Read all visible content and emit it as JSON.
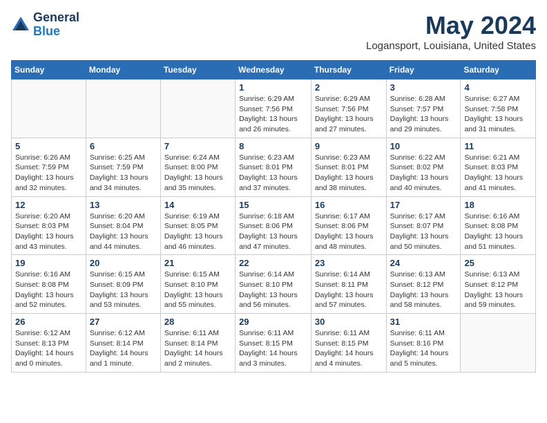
{
  "header": {
    "logo_general": "General",
    "logo_blue": "Blue",
    "month_title": "May 2024",
    "location": "Logansport, Louisiana, United States"
  },
  "calendar": {
    "days_of_week": [
      "Sunday",
      "Monday",
      "Tuesday",
      "Wednesday",
      "Thursday",
      "Friday",
      "Saturday"
    ],
    "weeks": [
      [
        {
          "day": "",
          "info": ""
        },
        {
          "day": "",
          "info": ""
        },
        {
          "day": "",
          "info": ""
        },
        {
          "day": "1",
          "info": "Sunrise: 6:29 AM\nSunset: 7:56 PM\nDaylight: 13 hours\nand 26 minutes."
        },
        {
          "day": "2",
          "info": "Sunrise: 6:29 AM\nSunset: 7:56 PM\nDaylight: 13 hours\nand 27 minutes."
        },
        {
          "day": "3",
          "info": "Sunrise: 6:28 AM\nSunset: 7:57 PM\nDaylight: 13 hours\nand 29 minutes."
        },
        {
          "day": "4",
          "info": "Sunrise: 6:27 AM\nSunset: 7:58 PM\nDaylight: 13 hours\nand 31 minutes."
        }
      ],
      [
        {
          "day": "5",
          "info": "Sunrise: 6:26 AM\nSunset: 7:59 PM\nDaylight: 13 hours\nand 32 minutes."
        },
        {
          "day": "6",
          "info": "Sunrise: 6:25 AM\nSunset: 7:59 PM\nDaylight: 13 hours\nand 34 minutes."
        },
        {
          "day": "7",
          "info": "Sunrise: 6:24 AM\nSunset: 8:00 PM\nDaylight: 13 hours\nand 35 minutes."
        },
        {
          "day": "8",
          "info": "Sunrise: 6:23 AM\nSunset: 8:01 PM\nDaylight: 13 hours\nand 37 minutes."
        },
        {
          "day": "9",
          "info": "Sunrise: 6:23 AM\nSunset: 8:01 PM\nDaylight: 13 hours\nand 38 minutes."
        },
        {
          "day": "10",
          "info": "Sunrise: 6:22 AM\nSunset: 8:02 PM\nDaylight: 13 hours\nand 40 minutes."
        },
        {
          "day": "11",
          "info": "Sunrise: 6:21 AM\nSunset: 8:03 PM\nDaylight: 13 hours\nand 41 minutes."
        }
      ],
      [
        {
          "day": "12",
          "info": "Sunrise: 6:20 AM\nSunset: 8:03 PM\nDaylight: 13 hours\nand 43 minutes."
        },
        {
          "day": "13",
          "info": "Sunrise: 6:20 AM\nSunset: 8:04 PM\nDaylight: 13 hours\nand 44 minutes."
        },
        {
          "day": "14",
          "info": "Sunrise: 6:19 AM\nSunset: 8:05 PM\nDaylight: 13 hours\nand 46 minutes."
        },
        {
          "day": "15",
          "info": "Sunrise: 6:18 AM\nSunset: 8:06 PM\nDaylight: 13 hours\nand 47 minutes."
        },
        {
          "day": "16",
          "info": "Sunrise: 6:17 AM\nSunset: 8:06 PM\nDaylight: 13 hours\nand 48 minutes."
        },
        {
          "day": "17",
          "info": "Sunrise: 6:17 AM\nSunset: 8:07 PM\nDaylight: 13 hours\nand 50 minutes."
        },
        {
          "day": "18",
          "info": "Sunrise: 6:16 AM\nSunset: 8:08 PM\nDaylight: 13 hours\nand 51 minutes."
        }
      ],
      [
        {
          "day": "19",
          "info": "Sunrise: 6:16 AM\nSunset: 8:08 PM\nDaylight: 13 hours\nand 52 minutes."
        },
        {
          "day": "20",
          "info": "Sunrise: 6:15 AM\nSunset: 8:09 PM\nDaylight: 13 hours\nand 53 minutes."
        },
        {
          "day": "21",
          "info": "Sunrise: 6:15 AM\nSunset: 8:10 PM\nDaylight: 13 hours\nand 55 minutes."
        },
        {
          "day": "22",
          "info": "Sunrise: 6:14 AM\nSunset: 8:10 PM\nDaylight: 13 hours\nand 56 minutes."
        },
        {
          "day": "23",
          "info": "Sunrise: 6:14 AM\nSunset: 8:11 PM\nDaylight: 13 hours\nand 57 minutes."
        },
        {
          "day": "24",
          "info": "Sunrise: 6:13 AM\nSunset: 8:12 PM\nDaylight: 13 hours\nand 58 minutes."
        },
        {
          "day": "25",
          "info": "Sunrise: 6:13 AM\nSunset: 8:12 PM\nDaylight: 13 hours\nand 59 minutes."
        }
      ],
      [
        {
          "day": "26",
          "info": "Sunrise: 6:12 AM\nSunset: 8:13 PM\nDaylight: 14 hours\nand 0 minutes."
        },
        {
          "day": "27",
          "info": "Sunrise: 6:12 AM\nSunset: 8:14 PM\nDaylight: 14 hours\nand 1 minute."
        },
        {
          "day": "28",
          "info": "Sunrise: 6:11 AM\nSunset: 8:14 PM\nDaylight: 14 hours\nand 2 minutes."
        },
        {
          "day": "29",
          "info": "Sunrise: 6:11 AM\nSunset: 8:15 PM\nDaylight: 14 hours\nand 3 minutes."
        },
        {
          "day": "30",
          "info": "Sunrise: 6:11 AM\nSunset: 8:15 PM\nDaylight: 14 hours\nand 4 minutes."
        },
        {
          "day": "31",
          "info": "Sunrise: 6:11 AM\nSunset: 8:16 PM\nDaylight: 14 hours\nand 5 minutes."
        },
        {
          "day": "",
          "info": ""
        }
      ]
    ]
  }
}
